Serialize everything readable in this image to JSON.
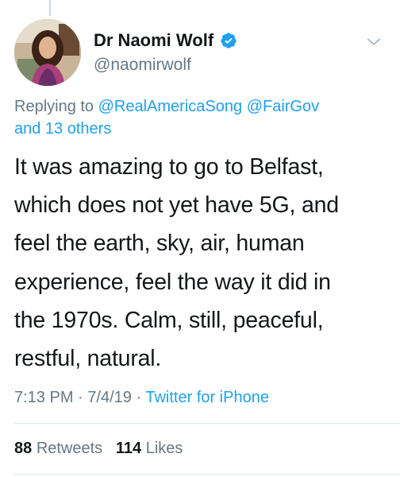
{
  "author": {
    "name": "Dr Naomi Wolf",
    "handle": "@naomirwolf",
    "verified": true,
    "avatar_icon": "profile-photo",
    "menu_icon": "chevron-down-icon"
  },
  "reply": {
    "prefix": "Replying to",
    "mentions": [
      "@RealAmericaSong",
      "@FairGov"
    ],
    "others": "and 13 others"
  },
  "tweet": {
    "lines": [
      "It was amazing to go to Belfast,",
      "which does not yet have 5G, and",
      "feel the earth, sky, air, human",
      "experience, feel the way it did in",
      "the 1970s. Calm, still, peaceful,",
      "restful, natural."
    ]
  },
  "meta": {
    "time": "7:13 PM",
    "date": "7/4/19",
    "separator": "·",
    "source": "Twitter for iPhone"
  },
  "stats": {
    "retweets_count": "88",
    "retweets_label": "Retweets",
    "likes_count": "114",
    "likes_label": "Likes"
  },
  "colors": {
    "link": "#1da1f2",
    "secondary_text": "#657786",
    "primary_text": "#14171a",
    "divider": "#e1e8ed"
  }
}
